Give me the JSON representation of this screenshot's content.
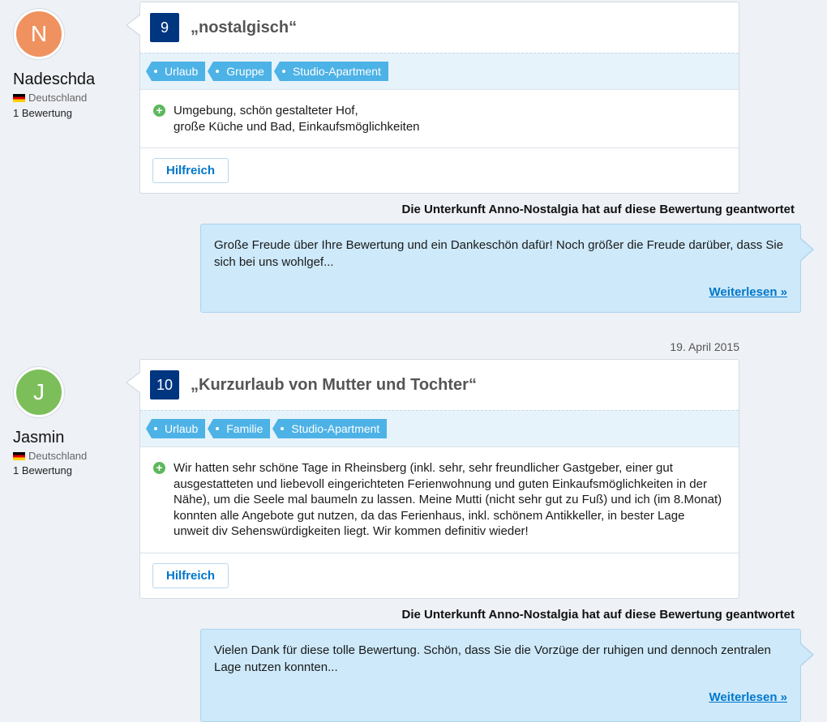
{
  "reviews": [
    {
      "avatar_letter": "N",
      "avatar_color": "#f0925f",
      "name": "Nadeschda",
      "country": "Deutschland",
      "review_count": "1 Bewertung",
      "score": "9",
      "title": "„nostalgisch“",
      "tags": [
        "Urlaub",
        "Gruppe",
        "Studio-Apartment"
      ],
      "pros": "Umgebung, schön gestalteter Hof,\ngroße Küche und Bad, Einkaufsmöglichkeiten",
      "helpful_label": "Hilfreich",
      "reply_heading": "Die Unterkunft Anno-Nostalgia hat auf diese Bewertung geantwortet",
      "reply_text": "Große Freude über Ihre Bewertung und ein Dankeschön dafür! Noch größer die Freude darüber, dass Sie sich bei uns wohlgef...",
      "read_more": "Weiterlesen »"
    },
    {
      "date": "19. April 2015",
      "avatar_letter": "J",
      "avatar_color": "#7cbf5a",
      "name": "Jasmin",
      "country": "Deutschland",
      "review_count": "1 Bewertung",
      "score": "10",
      "title": "„Kurzurlaub von Mutter und Tochter“",
      "tags": [
        "Urlaub",
        "Familie",
        "Studio-Apartment"
      ],
      "pros": "Wir hatten sehr schöne Tage in Rheinsberg (inkl. sehr, sehr freundlicher Gastgeber, einer gut ausgestatteten und liebevoll eingerichteten Ferienwohnung und guten Einkaufsmöglichkeiten in der Nähe), um die Seele mal baumeln zu lassen. Meine Mutti (nicht sehr gut zu Fuß) und ich (im 8.Monat) konnten alle Angebote gut nutzen, da das Ferienhaus, inkl. schönem Antikkeller, in bester Lage unweit div Sehenswürdigkeiten liegt. Wir kommen definitiv wieder!",
      "helpful_label": "Hilfreich",
      "reply_heading": "Die Unterkunft Anno-Nostalgia hat auf diese Bewertung geantwortet",
      "reply_text": "Vielen Dank für diese tolle Bewertung. Schön, dass Sie die Vorzüge der ruhigen und dennoch zentralen Lage nutzen konnten...",
      "read_more": "Weiterlesen »"
    }
  ]
}
